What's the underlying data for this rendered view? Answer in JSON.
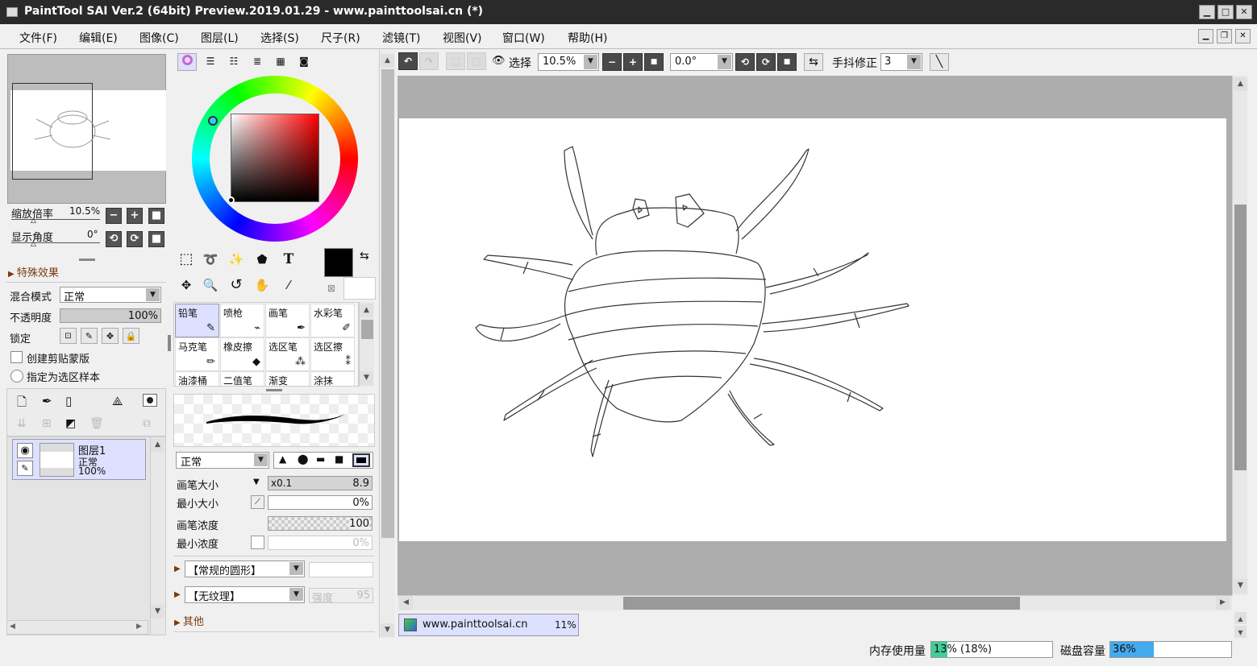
{
  "app": {
    "title": "PaintTool SAI Ver.2 (64bit) Preview.2019.01.29 - www.painttoolsai.cn (*)"
  },
  "window_controls": {
    "minimize": "▁",
    "maximize": "□",
    "close": "✕"
  },
  "menu": [
    "文件(F)",
    "编辑(E)",
    "图像(C)",
    "图层(L)",
    "选择(S)",
    "尺子(R)",
    "滤镜(T)",
    "视图(V)",
    "窗口(W)",
    "帮助(H)"
  ],
  "navigator": {
    "zoom_label": "缩放倍率",
    "zoom_value": "10.5%",
    "angle_label": "显示角度",
    "angle_value": "0°"
  },
  "effects": {
    "header": "特殊效果"
  },
  "layer_props": {
    "blend_label": "混合模式",
    "blend_value": "正常",
    "opacity_label": "不透明度",
    "opacity_value": "100%",
    "opacity": 1.0,
    "lock_label": "锁定",
    "clip_label": "创建剪贴蒙版",
    "sample_label": "指定为选区样本"
  },
  "layers": [
    {
      "name": "图层1",
      "mode": "正常",
      "opacity": "100%"
    }
  ],
  "color": {
    "current": "#000000",
    "secondary": "#ffffff",
    "hue_color": "#ff0000"
  },
  "brushes": [
    {
      "label": "铅笔",
      "icon": "✎",
      "selected": true
    },
    {
      "label": "喷枪",
      "icon": "⌁"
    },
    {
      "label": "画笔",
      "icon": "✒"
    },
    {
      "label": "水彩笔",
      "icon": "✐"
    },
    {
      "label": "马克笔",
      "icon": "✏"
    },
    {
      "label": "橡皮擦",
      "icon": "◆"
    },
    {
      "label": "选区笔",
      "icon": "⁂"
    },
    {
      "label": "选区擦",
      "icon": "⁑"
    },
    {
      "label": "油漆桶"
    },
    {
      "label": "二值笔"
    },
    {
      "label": "渐变"
    },
    {
      "label": "涂抹"
    }
  ],
  "brush_settings": {
    "mode": "正常",
    "size_label": "画笔大小",
    "size_mult": "x0.1",
    "size_value": "8.9",
    "min_size_label": "最小大小",
    "min_size_value": "0%",
    "density_label": "画笔浓度",
    "density_value": "100",
    "min_density_label": "最小浓度",
    "min_density_value": "0%",
    "shape": "【常规的圆形】",
    "texture": "【无纹理】",
    "texture_strength_label": "强度",
    "texture_strength_value": "95",
    "other_label": "其他"
  },
  "toolbar": {
    "select_label": "选择",
    "zoom": "10.5%",
    "angle": "0.0°",
    "stabilizer_label": "手抖修正",
    "stabilizer_value": "3"
  },
  "doc_tab": {
    "name": "www.painttoolsai.cn",
    "zoom": "11%"
  },
  "status": {
    "mem_label": "内存使用量",
    "mem_value": "13% (18%)",
    "mem_fraction": 0.13,
    "disk_label": "磁盘容量",
    "disk_value": "36%",
    "disk_fraction": 0.36
  }
}
